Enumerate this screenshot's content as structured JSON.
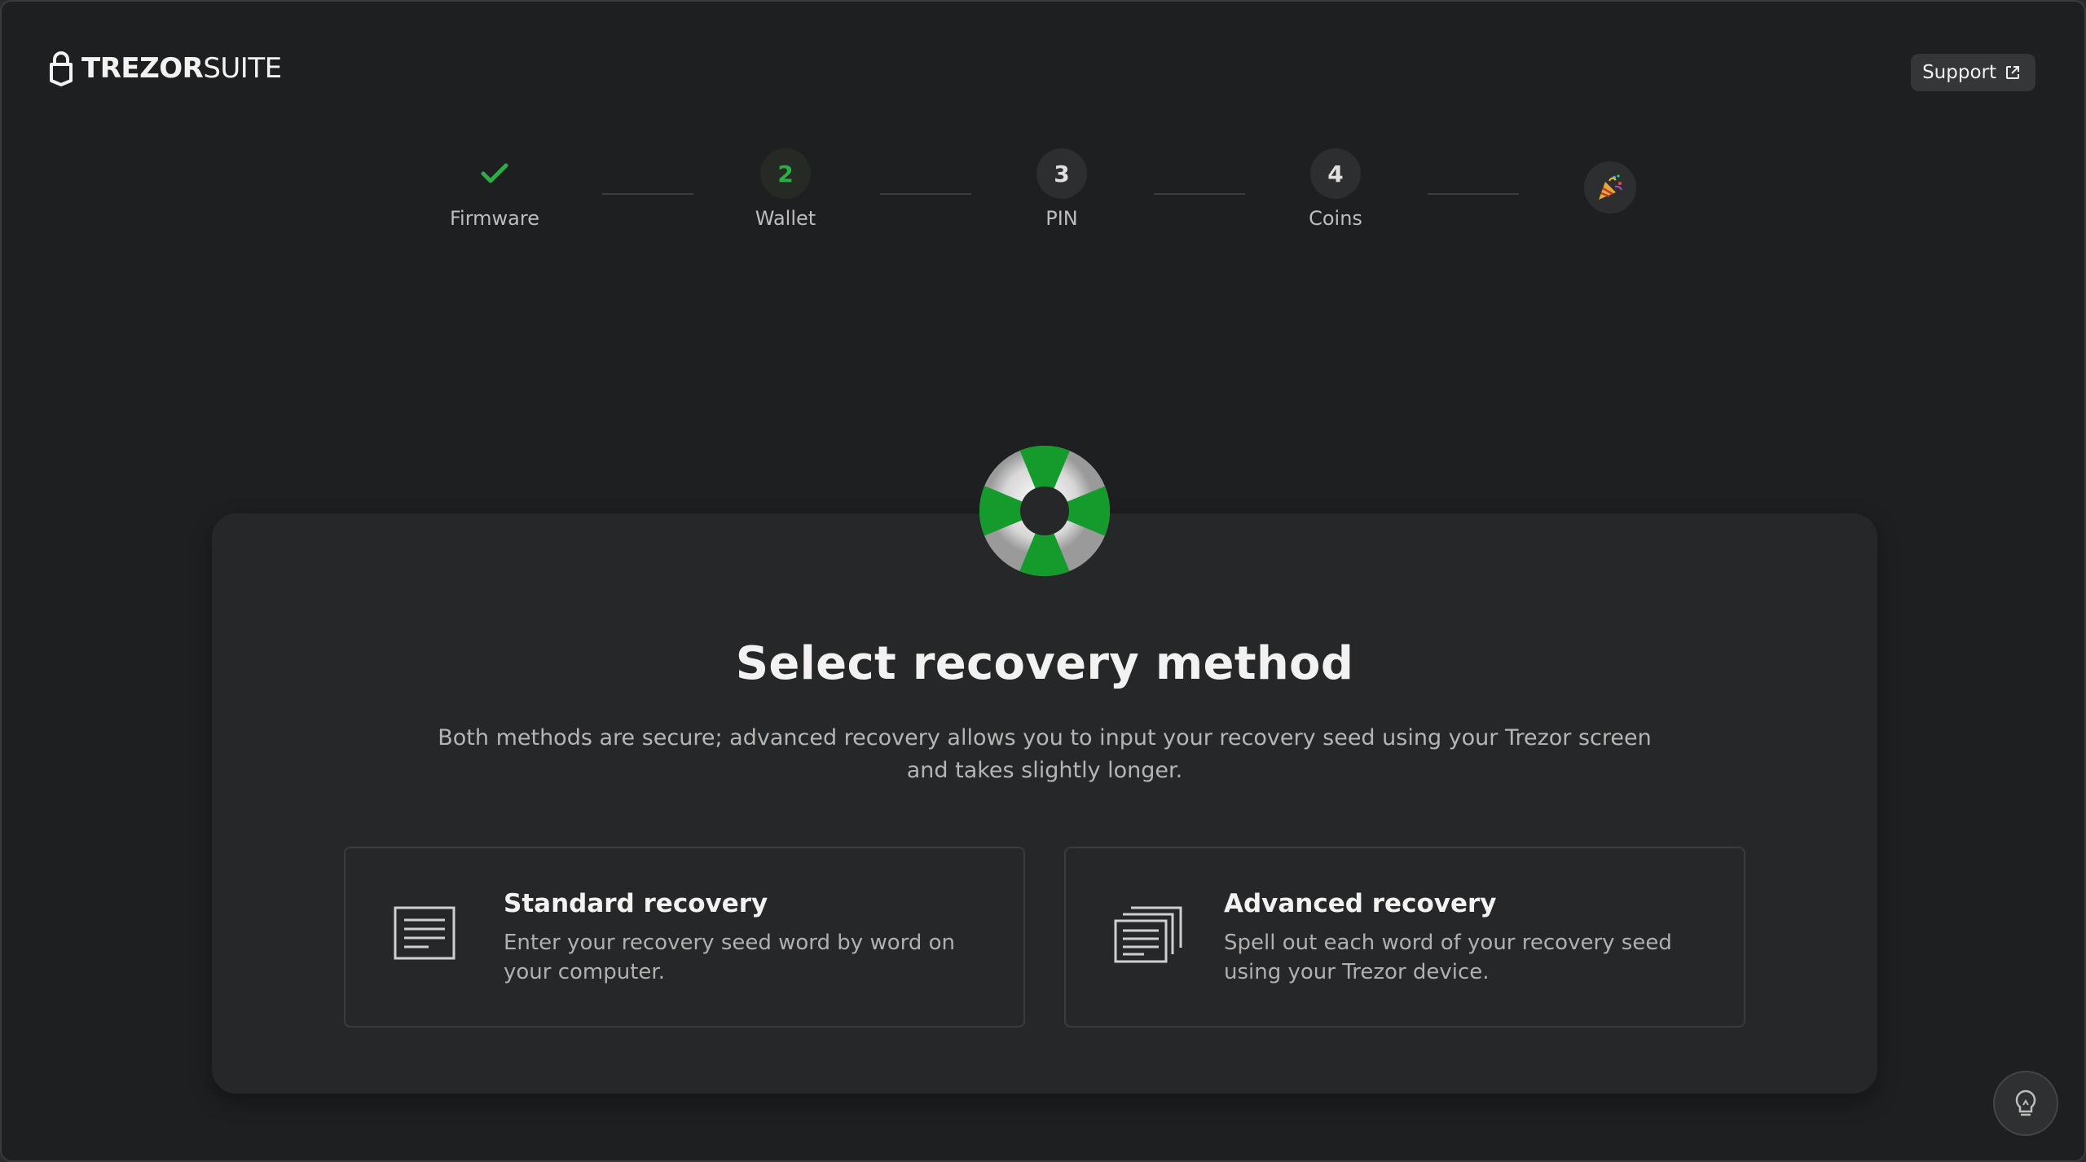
{
  "header": {
    "logo_bold": "TREZOR",
    "logo_light": "SUITE",
    "support_label": "Support"
  },
  "stepper": {
    "steps": [
      {
        "label": "Firmware",
        "status": "done",
        "number": ""
      },
      {
        "label": "Wallet",
        "status": "current",
        "number": "2"
      },
      {
        "label": "PIN",
        "status": "todo",
        "number": "3"
      },
      {
        "label": "Coins",
        "status": "todo",
        "number": "4"
      }
    ],
    "final_icon": "party-popper-icon"
  },
  "main": {
    "title": "Select recovery method",
    "description": "Both methods are secure; advanced recovery allows you to input your recovery seed using your Trezor screen and takes slightly longer.",
    "options": [
      {
        "title": "Standard recovery",
        "description": "Enter your recovery seed word by word on your computer.",
        "icon": "single-document-icon"
      },
      {
        "title": "Advanced recovery",
        "description": "Spell out each word of your recovery seed using your Trezor device.",
        "icon": "stacked-documents-icon"
      }
    ]
  },
  "colors": {
    "accent": "#2cad46",
    "background": "#1e1f20",
    "card": "#262728"
  }
}
